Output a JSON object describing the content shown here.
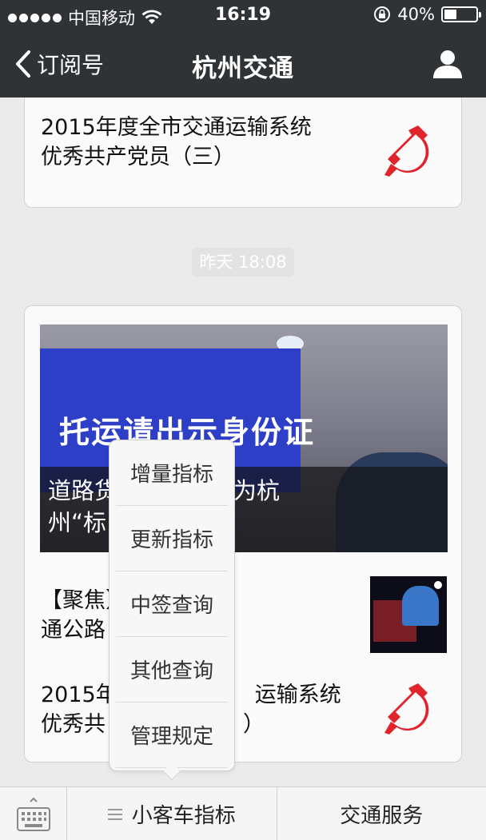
{
  "status_bar": {
    "carrier": "中国移动",
    "time": "16:19",
    "battery": "40%",
    "battery_level": 0.4,
    "icons": [
      "signal-dots-icon",
      "wifi-icon",
      "rotation-lock-icon",
      "battery-icon"
    ]
  },
  "nav": {
    "back_label": "订阅号",
    "title": "杭州交通",
    "icons": [
      "back-chevron-icon",
      "profile-icon"
    ]
  },
  "messages": {
    "card1": {
      "line1": "2015年度全市交通运输系统",
      "line2": "优秀共产党员（三）",
      "icon": "party-emblem-icon"
    },
    "timestamp": "昨天 18:08",
    "card2": {
      "photo_sign_text": "托运请出示身份证",
      "cover_line1": "道路货运实名制成为杭",
      "cover_line2": "州“标",
      "item1_line1": "【聚焦】  杭州交",
      "item1_line2": "通公路",
      "item1_line2_tail": "！",
      "item2_line1": "2015年",
      "item2_line1_tail": "运输系统",
      "item2_line2": "优秀共",
      "item2_line2_tail": "）",
      "icon": "party-emblem-icon"
    }
  },
  "popup_menu": {
    "items": [
      "增量指标",
      "更新指标",
      "中签查询",
      "其他查询",
      "管理规定"
    ]
  },
  "bottom_bar": {
    "menu1": "小客车指标",
    "menu2": "交通服务",
    "icons": [
      "keyboard-icon",
      "menu-lines-icon"
    ]
  },
  "colors": {
    "nav_bg": "#303336",
    "chat_bg": "#ebebeb",
    "emblem_red": "#e0242b"
  }
}
